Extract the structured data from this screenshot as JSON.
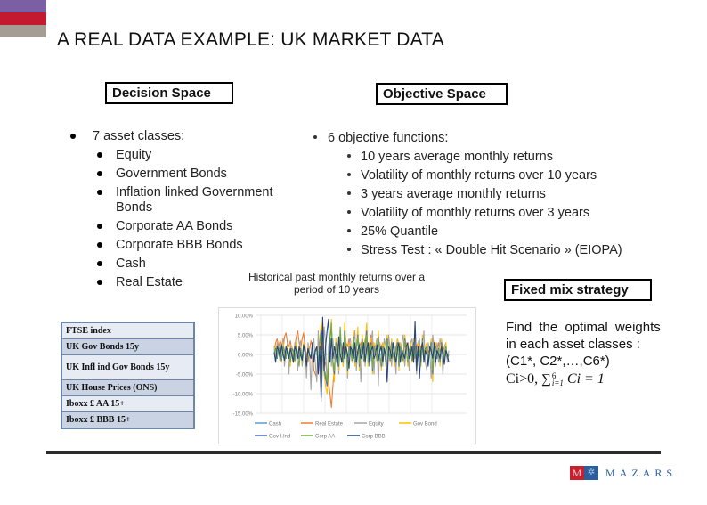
{
  "slide": {
    "title": "A REAL DATA EXAMPLE: UK MARKET DATA",
    "decision_space": {
      "label": "Decision Space",
      "main_bullet": "7 asset classes:",
      "items": [
        "Equity",
        "Government Bonds",
        "Inflation linked Government",
        "Bonds",
        "Corporate AA Bonds",
        "Corporate BBB Bonds",
        "Cash",
        "Real Estate"
      ]
    },
    "objective_space": {
      "label": "Objective Space",
      "main_bullet": "6 objective functions:",
      "items": [
        "10 years average monthly returns",
        "Volatility of monthly returns over 10 years",
        "3 years average monthly returns",
        "Volatility of monthly returns over 3 years",
        "25% Quantile",
        "Stress Test : « Double Hit  Scenario » (EIOPA)"
      ]
    },
    "chart_caption": "Historical past monthly returns over a period of 10 years",
    "index_table": [
      "FTSE index",
      "UK Gov Bonds 15y",
      "UK Infl ind Gov Bonds 15y",
      "UK House Prices (ONS)",
      "Iboxx £ AA 15+",
      "Iboxx £ BBB 15+"
    ],
    "fixed_mix": {
      "label": "Fixed mix strategy",
      "line1": "Find the optimal weights",
      "line2": "in each asset classes :",
      "line3": "(C1*, C2*,…,C6*)",
      "formula_prefix": "Ci>0, ",
      "formula_sum": "∑",
      "formula_sup": "6",
      "formula_sub": "i=1",
      "formula_rest": " Ci = 1"
    },
    "logo": {
      "text": "MAZARS",
      "mark_letter": "M"
    },
    "colors": {
      "accent_purple": "#7b5fa4",
      "accent_red": "#c41a30",
      "accent_gray": "#a49d93"
    }
  },
  "chart_data": {
    "type": "line",
    "title": "",
    "xlabel": "",
    "ylabel": "",
    "ylim": [
      -0.15,
      0.1
    ],
    "ytick_labels": [
      "10.00%",
      "5.00%",
      "0.00%",
      "-5.00%",
      "-10.00%",
      "-15.00%"
    ],
    "ytick_values": [
      0.1,
      0.05,
      0.0,
      -0.05,
      -0.1,
      -0.15
    ],
    "grid": true,
    "legend_position": "bottom",
    "n_points": 120,
    "series": [
      {
        "name": "Cash",
        "color": "#5b9bd5",
        "values": [
          0.002,
          0.001,
          0.002,
          0.001,
          0.002,
          0.001,
          0.002,
          0.001,
          0.002,
          0.001,
          0.002,
          0.001,
          0.002,
          0.001,
          0.002,
          0.001,
          0.002,
          0.001,
          0.002,
          0.001,
          0.001,
          0.001,
          0.001,
          0.001,
          0.001,
          0.001,
          0.001,
          0.001,
          0.001,
          0.001,
          0.001,
          0.001,
          0.001,
          0.001,
          0.001,
          0.001,
          0.001,
          0.001,
          0.001,
          0.001,
          0.0,
          0.0,
          0.0,
          0.0,
          0.0,
          0.0,
          0.0,
          0.0,
          0.0,
          0.0,
          0.0,
          0.0,
          0.0,
          0.0,
          0.0,
          0.0,
          0.0,
          0.0,
          0.0,
          0.0,
          0.0,
          0.0,
          0.0,
          0.0,
          0.0,
          0.0,
          0.0,
          0.0,
          0.0,
          0.0,
          0.0,
          0.0,
          0.0,
          0.0,
          0.0,
          0.0,
          0.0,
          0.0,
          0.0,
          0.0,
          0.0,
          0.0,
          0.0,
          0.0,
          0.0,
          0.0,
          0.0,
          0.0,
          0.0,
          0.0,
          0.0,
          0.0,
          0.0,
          0.0,
          0.0,
          0.0,
          0.0,
          0.0,
          0.0,
          0.0,
          0.0,
          0.0,
          0.0,
          0.0,
          0.0,
          0.0,
          0.0,
          0.0,
          0.0,
          0.0,
          0.0,
          0.0,
          0.0,
          0.0,
          0.0,
          0.0,
          0.0,
          0.0,
          0.0,
          0.0
        ]
      },
      {
        "name": "Real Estate",
        "color": "#ed7d31",
        "values": [
          0.01,
          0.03,
          0.04,
          0.02,
          0.035,
          0.025,
          0.01,
          0.045,
          0.055,
          0.03,
          0.02,
          0.035,
          0.01,
          -0.01,
          0.02,
          0.045,
          0.06,
          0.03,
          0.01,
          0.04,
          0.055,
          0.02,
          0.0,
          -0.02,
          0.01,
          0.035,
          0.02,
          -0.04,
          -0.05,
          -0.06,
          -0.02,
          0.01,
          0.03,
          0.0,
          -0.03,
          -0.02,
          -0.05,
          -0.07,
          -0.1,
          -0.135,
          -0.08,
          -0.03,
          0.01,
          0.02,
          0.03,
          0.04,
          0.02,
          0.0,
          0.01,
          0.03,
          0.02,
          0.04,
          0.01,
          -0.01,
          0.02,
          0.03,
          0.01,
          0.0,
          0.02,
          0.03,
          0.01,
          0.02,
          0.04,
          0.02,
          0.01,
          0.03,
          0.05,
          0.02,
          0.0,
          0.02,
          0.04,
          0.03,
          0.01,
          0.02,
          0.03,
          0.01,
          0.0,
          0.02,
          0.04,
          0.02,
          0.01,
          0.0,
          -0.01,
          0.02,
          0.03,
          0.01,
          0.02,
          0.0,
          0.01,
          0.02,
          0.03,
          0.01,
          0.0,
          0.02,
          0.01,
          0.0,
          -0.01,
          0.02,
          0.03,
          0.01,
          0.02,
          0.03,
          0.01,
          0.0,
          0.02,
          0.01,
          0.0,
          0.02,
          0.04,
          0.02,
          0.01,
          0.0,
          0.03,
          0.01,
          0.0,
          0.02,
          0.01,
          0.0,
          -0.01,
          0.0
        ]
      },
      {
        "name": "Equity",
        "color": "#a5a5a5",
        "values": [
          0.02,
          -0.01,
          0.03,
          0.01,
          -0.02,
          0.02,
          0.04,
          -0.03,
          0.01,
          0.03,
          -0.05,
          0.02,
          0.01,
          -0.02,
          0.03,
          0.0,
          -0.04,
          0.02,
          0.035,
          -0.03,
          0.01,
          0.02,
          -0.06,
          0.03,
          0.01,
          -0.09,
          0.02,
          0.04,
          -0.02,
          -0.07,
          0.06,
          -0.04,
          -0.12,
          -0.02,
          0.07,
          0.03,
          -0.08,
          0.02,
          0.05,
          -0.03,
          0.04,
          -0.01,
          0.03,
          0.02,
          -0.05,
          0.04,
          0.01,
          -0.03,
          0.05,
          0.02,
          -0.06,
          0.03,
          0.04,
          -0.02,
          0.02,
          0.06,
          -0.04,
          0.01,
          0.03,
          -0.07,
          0.04,
          0.02,
          -0.03,
          0.05,
          0.0,
          -0.02,
          0.03,
          0.06,
          -0.05,
          0.02,
          0.04,
          -0.08,
          0.03,
          0.01,
          -0.03,
          0.04,
          0.02,
          -0.04,
          0.05,
          0.01,
          -0.03,
          0.03,
          0.02,
          -0.05,
          0.04,
          0.02,
          -0.02,
          0.03,
          0.05,
          -0.03,
          0.01,
          0.02,
          -0.04,
          0.03,
          0.04,
          -0.02,
          0.02,
          -0.05,
          0.03,
          0.04,
          -0.03,
          0.02,
          0.06,
          -0.02,
          -0.04,
          0.03,
          0.01,
          -0.06,
          0.05,
          0.02,
          -0.03,
          0.03,
          -0.02,
          0.04,
          0.01,
          -0.05,
          0.02,
          0.03,
          -0.02,
          0.01
        ]
      },
      {
        "name": "Gov Bond",
        "color": "#ffc000",
        "values": [
          0.01,
          0.02,
          -0.01,
          0.02,
          0.0,
          -0.02,
          0.03,
          0.01,
          -0.01,
          0.02,
          0.0,
          -0.03,
          0.02,
          0.01,
          -0.02,
          0.03,
          0.0,
          -0.01,
          0.02,
          -0.02,
          0.03,
          0.01,
          -0.03,
          0.02,
          0.0,
          -0.01,
          0.03,
          -0.02,
          0.01,
          0.02,
          -0.03,
          0.04,
          0.08,
          0.02,
          -0.05,
          -0.08,
          -0.1,
          -0.06,
          0.05,
          0.09,
          -0.03,
          -0.07,
          0.04,
          0.02,
          -0.04,
          0.06,
          0.0,
          -0.03,
          0.08,
          0.02,
          -0.05,
          0.03,
          0.01,
          -0.02,
          0.06,
          -0.03,
          0.02,
          0.07,
          -0.04,
          0.01,
          0.05,
          -0.02,
          0.03,
          0.08,
          -0.03,
          0.02,
          0.04,
          -0.05,
          0.03,
          0.01,
          -0.02,
          0.06,
          0.0,
          -0.04,
          0.03,
          0.02,
          -0.03,
          0.05,
          0.01,
          -0.02,
          0.04,
          0.0,
          -0.03,
          0.02,
          0.04,
          -0.04,
          0.03,
          0.01,
          -0.02,
          0.05,
          0.02,
          -0.03,
          0.01,
          0.03,
          -0.02,
          0.04,
          0.0,
          -0.02,
          0.03,
          0.01,
          -0.03,
          0.05,
          -0.01,
          0.02,
          0.03,
          -0.02,
          0.01,
          0.04,
          -0.07,
          0.02,
          0.03,
          -0.01,
          0.02,
          -0.03,
          0.04,
          0.01,
          -0.02,
          0.03,
          -0.01,
          0.0
        ]
      },
      {
        "name": "Gov I.Ind",
        "color": "#4472c4",
        "values": [
          0.005,
          0.015,
          -0.01,
          0.02,
          0.0,
          -0.015,
          0.02,
          0.01,
          -0.01,
          0.015,
          0.0,
          -0.02,
          0.015,
          0.01,
          -0.015,
          0.02,
          0.0,
          -0.01,
          0.015,
          -0.015,
          0.02,
          0.01,
          -0.02,
          0.015,
          0.0,
          -0.01,
          0.02,
          -0.015,
          0.01,
          0.015,
          -0.02,
          0.03,
          0.06,
          0.015,
          -0.04,
          -0.06,
          -0.08,
          -0.04,
          0.04,
          0.07,
          -0.02,
          -0.05,
          0.03,
          0.015,
          -0.03,
          0.045,
          0.0,
          -0.02,
          0.06,
          0.015,
          -0.04,
          0.02,
          0.01,
          -0.015,
          0.045,
          -0.02,
          0.015,
          0.05,
          -0.03,
          0.01,
          0.04,
          -0.015,
          0.02,
          0.06,
          -0.02,
          0.015,
          0.03,
          -0.04,
          0.02,
          0.01,
          -0.015,
          0.045,
          0.0,
          -0.03,
          0.02,
          0.015,
          -0.02,
          0.04,
          0.01,
          -0.015,
          0.03,
          0.0,
          -0.02,
          0.015,
          0.03,
          -0.03,
          0.02,
          0.01,
          -0.015,
          0.04,
          0.015,
          -0.02,
          0.01,
          0.02,
          -0.015,
          0.03,
          0.0,
          -0.015,
          0.02,
          0.01,
          -0.02,
          0.04,
          -0.01,
          0.015,
          0.02,
          -0.015,
          0.01,
          0.03,
          -0.05,
          0.015,
          0.02,
          -0.01,
          0.015,
          -0.02,
          0.03,
          0.01,
          -0.015,
          0.02,
          -0.01,
          0.0
        ]
      },
      {
        "name": "Corp AA",
        "color": "#70ad47",
        "values": [
          0.008,
          0.012,
          -0.008,
          0.018,
          0.0,
          -0.012,
          0.018,
          0.008,
          -0.008,
          0.012,
          0.0,
          -0.018,
          0.012,
          0.008,
          -0.012,
          0.018,
          0.0,
          -0.03,
          0.012,
          -0.012,
          0.018,
          0.008,
          -0.018,
          0.012,
          0.0,
          -0.008,
          0.018,
          -0.012,
          0.008,
          0.012,
          -0.018,
          0.025,
          0.05,
          0.012,
          -0.035,
          -0.05,
          -0.07,
          -0.03,
          0.035,
          0.08,
          -0.018,
          -0.04,
          0.025,
          0.012,
          -0.025,
          0.07,
          0.0,
          -0.018,
          0.05,
          0.012,
          -0.035,
          0.018,
          0.008,
          -0.012,
          0.04,
          -0.018,
          0.012,
          0.045,
          -0.025,
          0.008,
          0.035,
          -0.012,
          0.018,
          0.05,
          -0.018,
          0.012,
          0.025,
          -0.035,
          0.018,
          0.008,
          -0.012,
          0.04,
          0.0,
          -0.025,
          0.018,
          0.012,
          -0.018,
          0.035,
          0.008,
          -0.012,
          0.025,
          0.0,
          -0.018,
          0.012,
          0.025,
          -0.025,
          0.018,
          0.008,
          -0.012,
          0.035,
          0.012,
          -0.018,
          0.008,
          0.018,
          -0.012,
          0.025,
          0.0,
          -0.012,
          0.018,
          0.008,
          -0.018,
          0.035,
          -0.008,
          0.012,
          0.018,
          -0.012,
          0.008,
          0.025,
          -0.04,
          0.012,
          0.018,
          -0.008,
          0.012,
          -0.018,
          0.025,
          0.008,
          -0.012,
          0.018,
          -0.008,
          0.0
        ]
      },
      {
        "name": "Corp BBB",
        "color": "#264478",
        "values": [
          0.005,
          -0.02,
          0.02,
          0.01,
          -0.01,
          0.025,
          0.0,
          -0.015,
          0.02,
          0.005,
          -0.01,
          0.015,
          0.0,
          -0.02,
          0.02,
          0.01,
          -0.01,
          0.02,
          0.0,
          -0.015,
          0.025,
          0.005,
          -0.03,
          0.015,
          0.0,
          -0.01,
          0.03,
          -0.02,
          0.01,
          0.02,
          -0.05,
          0.02,
          -0.11,
          0.095,
          -0.04,
          0.02,
          0.06,
          0.09,
          -0.02,
          0.04,
          -0.01,
          0.02,
          0.0,
          -0.03,
          0.045,
          0.0,
          -0.02,
          0.03,
          -0.01,
          0.02,
          0.0,
          -0.035,
          0.02,
          0.01,
          -0.01,
          0.03,
          -0.02,
          0.01,
          0.025,
          -0.01,
          0.0,
          0.03,
          -0.02,
          0.015,
          0.03,
          -0.03,
          0.01,
          0.02,
          -0.01,
          0.0,
          0.025,
          -0.015,
          0.01,
          0.02,
          -0.02,
          0.015,
          0.0,
          -0.07,
          0.02,
          0.01,
          -0.01,
          0.03,
          0.0,
          -0.02,
          0.015,
          0.03,
          -0.02,
          0.01,
          0.0,
          -0.01,
          0.02,
          0.03,
          -0.01,
          0.0,
          0.02,
          -0.02,
          0.085,
          -0.04,
          0.02,
          -0.06,
          0.01,
          0.03,
          -0.02,
          0.01,
          0.0,
          -0.03,
          0.02,
          0.01,
          -0.01,
          0.03,
          -0.02,
          0.01,
          0.0,
          -0.01,
          0.02,
          0.0,
          -0.025,
          0.01,
          0.0,
          -0.02
        ]
      }
    ]
  }
}
